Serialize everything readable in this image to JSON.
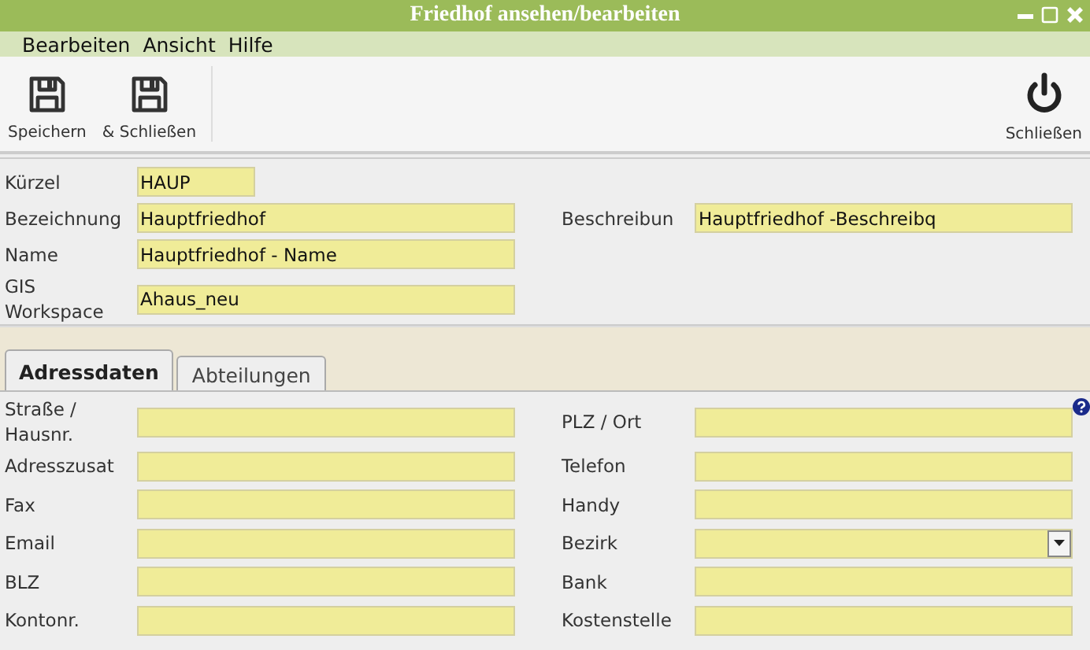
{
  "window": {
    "title": "Friedhof ansehen/bearbeiten"
  },
  "menu": [
    "Bearbeiten",
    "Ansicht",
    "Hilfe"
  ],
  "toolbar": {
    "left": [
      {
        "label": "Speichern",
        "kind": "save"
      },
      {
        "label": "& Schließen",
        "kind": "save"
      }
    ],
    "right": [
      {
        "label": "Schließen",
        "kind": "power"
      }
    ]
  },
  "header_fields": [
    {
      "label": "Kürzel",
      "value": "HAUP",
      "kind": "short"
    },
    {
      "label": "Bezeichnung",
      "value": "Hauptfriedhof",
      "kind": "text",
      "right": {
        "label": "Beschreibun",
        "value": "Hauptfriedhof -Beschreibq"
      }
    },
    {
      "label": "Name",
      "value": "Hauptfriedhof - Name",
      "kind": "text"
    },
    {
      "label": "GIS Workspace",
      "value": "Ahaus_neu",
      "kind": "text"
    }
  ],
  "tabs": [
    {
      "label": "Adressdaten",
      "selected": true
    },
    {
      "label": "Abteilungen",
      "selected": false
    }
  ],
  "address_rows": [
    {
      "left": {
        "label": "Straße / Hausnr.",
        "kind": "text"
      },
      "right": {
        "label": "PLZ / Ort",
        "kind": "text",
        "help": true
      }
    },
    {
      "left": {
        "label": "Adresszusat",
        "kind": "text"
      },
      "right": {
        "label": "Telefon",
        "kind": "text",
        "help": false
      }
    },
    {
      "left": {
        "label": "Fax",
        "kind": "text"
      },
      "right": {
        "label": "Handy",
        "kind": "text",
        "help": false
      }
    },
    {
      "left": {
        "label": "Email",
        "kind": "text"
      },
      "right": {
        "label": "Bezirk",
        "kind": "select",
        "help": false
      }
    },
    {
      "left": {
        "label": "BLZ",
        "kind": "text"
      },
      "right": {
        "label": "Bank",
        "kind": "text",
        "help": false
      }
    },
    {
      "left": {
        "label": "Kontonr.",
        "kind": "text"
      },
      "right": {
        "label": "Kostenstelle",
        "kind": "text",
        "help": false
      }
    }
  ]
}
